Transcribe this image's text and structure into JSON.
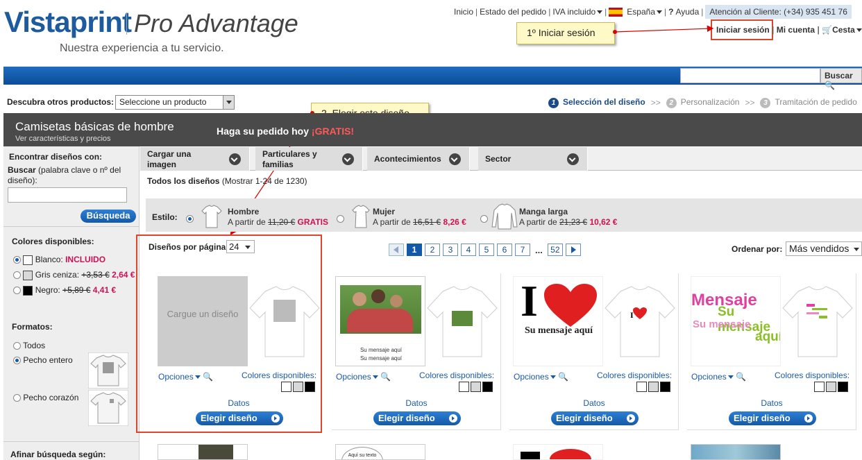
{
  "header": {
    "logo": "Vistaprint",
    "logo_sub": "Pro Advantage",
    "tagline": "Nuestra experiencia a tu servicio.",
    "nav": [
      "Inicio",
      "Estado del pedido",
      "IVA incluido",
      "España",
      "Ayuda"
    ],
    "service": "Atención al Cliente: (+34) 935 451 76",
    "login": "Iniciar sesión",
    "account": "Mi cuenta",
    "cart": "Cesta",
    "search_btn": "Buscar"
  },
  "callouts": {
    "step1": "1º Iniciar sesión",
    "step2": "2. Elegir este diseño"
  },
  "subbar": {
    "discover_label": "Descubra otros productos:",
    "product_select": "Seleccione un producto",
    "steps": [
      {
        "num": "1",
        "label": "Selección del diseño"
      },
      {
        "num": "2",
        "label": "Personalización"
      },
      {
        "num": "3",
        "label": "Tramitación de pedido"
      }
    ],
    "arrow": ">>"
  },
  "band": {
    "title": "Camisetas básicas de hombre",
    "subtitle": "Ver características y precios",
    "promo": "Haga su pedido hoy",
    "promo_free": "¡GRATIS!"
  },
  "sidebar": {
    "find_title": "Encontrar diseños con:",
    "search_label": "Buscar",
    "search_hint": "(palabra clave o nº del diseño):",
    "search_btn": "Búsqueda",
    "colors_title": "Colores disponibles:",
    "colors": [
      {
        "name": "Blanco:",
        "price": "INCLUIDO",
        "old": "",
        "swatch": "#ffffff",
        "selected": true
      },
      {
        "name": "Gris ceniza:",
        "old": "+3,53 €",
        "price": "2,64 €",
        "swatch": "#d8d8d8",
        "selected": false
      },
      {
        "name": "Negro:",
        "old": "+5,89 €",
        "price": "4,41 €",
        "swatch": "#000000",
        "selected": false
      }
    ],
    "formats_title": "Formatos:",
    "formats": [
      "Todos",
      "Pecho entero",
      "Pecho corazón"
    ],
    "refine_title": "Afinar búsqueda según:"
  },
  "tabs": [
    "Cargar una imagen",
    "Particulares y familias",
    "Acontecimientos",
    "Sector"
  ],
  "listing": {
    "all": "Todos los diseños",
    "count": "(Mostrar 1-24 de 1230)",
    "style_label": "Estilo:",
    "styles": [
      {
        "name": "Hombre",
        "from": "A partir de",
        "old": "11,20 €",
        "new": "GRATIS"
      },
      {
        "name": "Mujer",
        "from": "A partir de",
        "old": "16,51 €",
        "new": "8,26 €"
      },
      {
        "name": "Manga larga",
        "from": "A partir de",
        "old": "21,23 €",
        "new": "10,62 €"
      }
    ],
    "per_page_label": "Diseños por página",
    "per_page": "24",
    "pages": [
      "1",
      "2",
      "3",
      "4",
      "5",
      "6",
      "7"
    ],
    "ellipsis": "...",
    "last_page": "52",
    "sort_label": "Ordenar por:",
    "sort_value": "Más vendidos"
  },
  "cards": {
    "upload_text": "Cargue un diseño",
    "options": "Opciones",
    "colors": "Colores disponibles:",
    "datos": "Datos",
    "choose": "Elegir diseño",
    "msg1": "Su mensaje aquí",
    "love": "I",
    "love_msg": "Su mensaje aquí",
    "mensaje1": "Mensaje",
    "mensaje2": "Su mensaje",
    "mensaje3": "Su mensaje",
    "mensaje4": "aquí",
    "small_text": "Aquí su texto"
  }
}
